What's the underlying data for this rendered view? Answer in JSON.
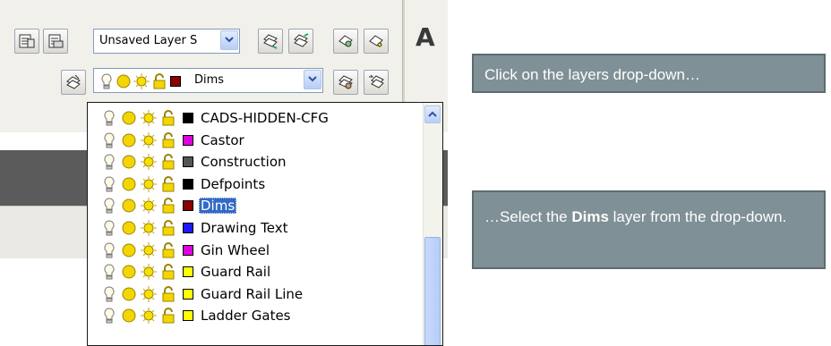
{
  "toolbar": {
    "layer_state_value": "Unsaved Layer S",
    "current_layer": "Dims",
    "current_layer_color": "#8b0000",
    "text_tool_glyph": "A"
  },
  "dropdown": {
    "items": [
      {
        "name": "CADS-HIDDEN-CFG",
        "color": "#000000"
      },
      {
        "name": "Castor",
        "color": "#e000e0"
      },
      {
        "name": "Construction",
        "color": "#555555"
      },
      {
        "name": "Defpoints",
        "color": "#000000"
      },
      {
        "name": "Dims",
        "color": "#8b0000",
        "selected": true
      },
      {
        "name": "Drawing Text",
        "color": "#1a1aff"
      },
      {
        "name": "Gin Wheel",
        "color": "#e000e0"
      },
      {
        "name": "Guard Rail",
        "color": "#ffff00"
      },
      {
        "name": "Guard Rail Line",
        "color": "#ffff00"
      },
      {
        "name": "Ladder Gates",
        "color": "#ffff00"
      }
    ],
    "selection_color": "#316ac5"
  },
  "callouts": {
    "first": "Click on the layers drop-down…",
    "second_pre": "…Select the ",
    "second_bold": "Dims",
    "second_post": " layer from the drop-down."
  },
  "icons": {
    "layer_row": [
      "lightbulb-icon",
      "sun-icon",
      "freeze-sun-icon",
      "lock-icon"
    ]
  }
}
